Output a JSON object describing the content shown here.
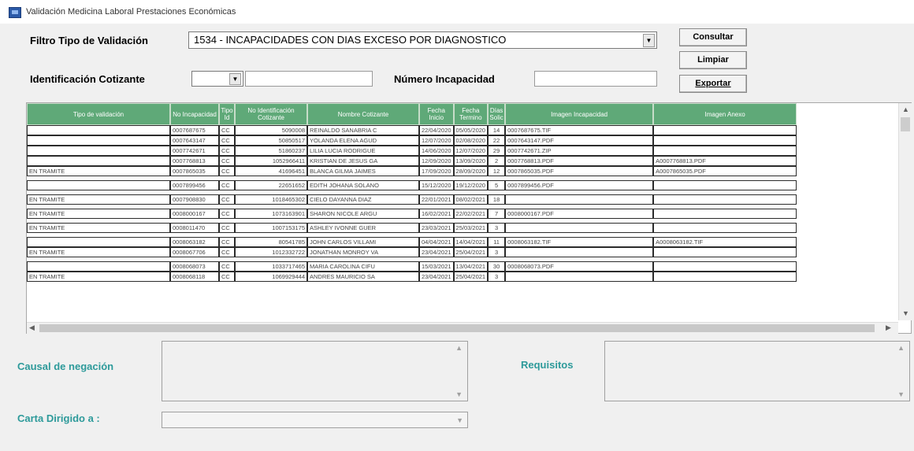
{
  "window": {
    "title": "Validación Medicina Laboral Prestaciones Económicas"
  },
  "filters": {
    "tipo_label": "Filtro Tipo de Validación",
    "tipo_value": "1534 - INCAPACIDADES CON DIAS EXCESO POR DIAGNOSTICO",
    "id_label": "Identificación Cotizante",
    "id_type_value": "",
    "id_value": "",
    "num_label": "Número Incapacidad",
    "num_value": ""
  },
  "buttons": {
    "consultar": "Consultar",
    "limpiar": "Limpiar",
    "exportar": "Exportar"
  },
  "grid": {
    "headers": [
      "Tipo de validación",
      "No Incapacidad",
      "Tipo Id",
      "No Identificación Cotizante",
      "Nombre Cotizante",
      "Fecha Inicio",
      "Fecha Termino",
      "Días Solic",
      "Imagen Incapacidad",
      "Imagen Anexo"
    ],
    "rows": [
      [
        "",
        "0007687675",
        "CC",
        "5090008",
        "REINALDO SANABRIA C",
        "22/04/2020",
        "05/05/2020",
        "14",
        "0007687675.TIF",
        ""
      ],
      [
        "",
        "0007643147",
        "CC",
        "50850517",
        "YOLANDA ELENA AGUD",
        "12/07/2020",
        "02/08/2020",
        "22",
        "0007643147.PDF",
        ""
      ],
      [
        "",
        "0007742671",
        "CC",
        "51860237",
        "LILIA LUCIA RODRIGUE",
        "14/06/2020",
        "12/07/2020",
        "29",
        "0007742671.ZIP",
        ""
      ],
      [
        "",
        "0007768813",
        "CC",
        "1052966411",
        "KRISTIAN DE JESUS GA",
        "12/09/2020",
        "13/09/2020",
        "2",
        "0007768813.PDF",
        "A0007768813.PDF"
      ],
      [
        "EN TRAMITE",
        "0007865035",
        "CC",
        "41696451",
        "BLANCA GILMA JAIMES",
        "17/09/2020",
        "28/09/2020",
        "12",
        "0007865035.PDF",
        "A0007865035.PDF"
      ],
      [
        "",
        "0007899456",
        "CC",
        "22651652",
        "EDITH JOHANA SOLANO",
        "15/12/2020",
        "19/12/2020",
        "5",
        "0007899456.PDF",
        ""
      ],
      [
        "EN TRAMITE",
        "0007908830",
        "CC",
        "1018465302",
        "CIELO DAYANNA DIAZ",
        "22/01/2021",
        "08/02/2021",
        "18",
        "",
        ""
      ],
      [
        "EN TRAMITE",
        "0008000167",
        "CC",
        "1073163901",
        "SHARON NICOLE ARGU",
        "16/02/2021",
        "22/02/2021",
        "7",
        "0008000167.PDF",
        ""
      ],
      [
        "EN TRAMITE",
        "0008011470",
        "CC",
        "1007153175",
        "ASHLEY IVONNE GUER",
        "23/03/2021",
        "25/03/2021",
        "3",
        "",
        ""
      ],
      [
        "",
        "0008063182",
        "CC",
        "80541785",
        "JOHN CARLOS VILLAMI",
        "04/04/2021",
        "14/04/2021",
        "11",
        "0008063182.TIF",
        "A0008063182.TIF"
      ],
      [
        "EN TRAMITE",
        "0008067706",
        "CC",
        "1012332722",
        "JONATHAN MONROY VA",
        "23/04/2021",
        "25/04/2021",
        "3",
        "",
        ""
      ],
      [
        "",
        "0008068073",
        "CC",
        "1033717465",
        "MARIA CAROLINA CIFU",
        "15/03/2021",
        "13/04/2021",
        "30",
        "0008068073.PDF",
        ""
      ],
      [
        "EN TRAMITE",
        "0008068118",
        "CC",
        "1069929444",
        "ANDRES MAURICIO SA",
        "23/04/2021",
        "25/04/2021",
        "3",
        "",
        ""
      ]
    ],
    "gap_after": [
      4,
      5,
      6,
      7,
      8,
      10
    ]
  },
  "bottom": {
    "causal_label": "Causal de negación",
    "causal_value": "",
    "requisitos_label": "Requisitos",
    "requisitos_value": "",
    "carta_label": "Carta Dirigido a :",
    "carta_value": ""
  },
  "colors": {
    "header_bg": "#5fa978",
    "label_teal": "#2d9a9a"
  }
}
